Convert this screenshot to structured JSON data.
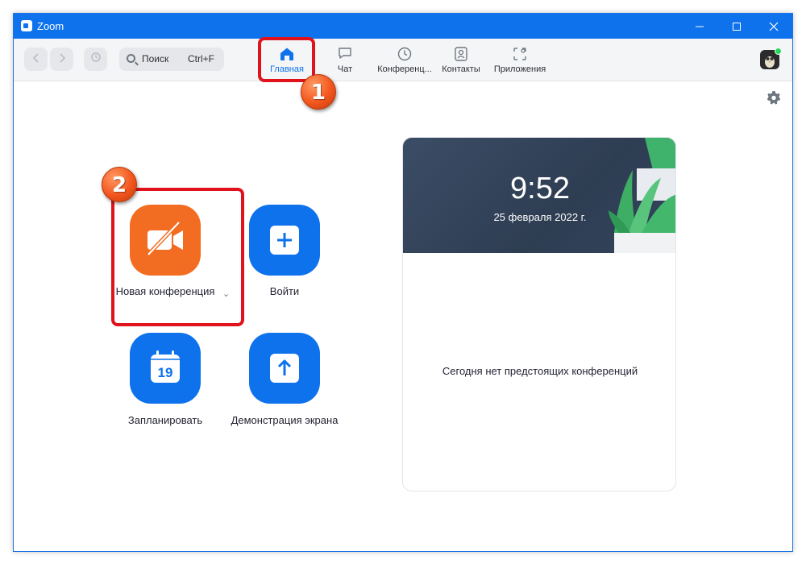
{
  "window": {
    "title": "Zoom"
  },
  "toolbar": {
    "search_placeholder": "Поиск",
    "search_shortcut": "Ctrl+F",
    "tabs": [
      {
        "label": "Главная",
        "icon": "home-icon",
        "active": true
      },
      {
        "label": "Чат",
        "icon": "chat-icon",
        "active": false
      },
      {
        "label": "Конференц...",
        "icon": "clock-icon",
        "active": false
      },
      {
        "label": "Контакты",
        "icon": "contacts-icon",
        "active": false
      },
      {
        "label": "Приложения",
        "icon": "apps-icon",
        "active": false
      }
    ]
  },
  "actions": {
    "new_meeting": "Новая конференция",
    "join": "Войти",
    "schedule": "Запланировать",
    "schedule_day": "19",
    "share_screen": "Демонстрация экрана"
  },
  "meetings_card": {
    "time": "9:52",
    "date": "25 февраля 2022 г.",
    "empty_text": "Сегодня нет предстоящих конференций"
  },
  "annotations": {
    "marker_1": "1",
    "marker_2": "2"
  },
  "colors": {
    "accent": "#0e72ed",
    "orange": "#f26d21",
    "annotation_red": "#e0121b"
  }
}
